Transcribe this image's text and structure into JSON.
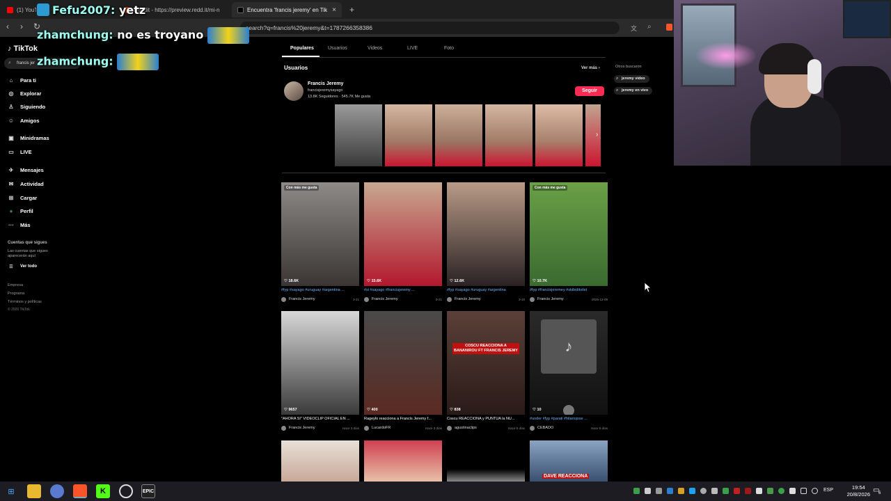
{
  "browser": {
    "tabs": [
      {
        "label": "(1) YouTu",
        "active": false
      },
      {
        "label": "Reddit - https://preview.redd.it/mi-n",
        "active": false
      },
      {
        "label": "Encuentra 'francis jeremy' en Tik",
        "active": true
      }
    ],
    "new_tab": "+",
    "url": "search?q=francis%20jeremy&t=1787266358386"
  },
  "chat": [
    {
      "user": "Fefu2007:",
      "message": "yetz"
    },
    {
      "user": "zhamchung:",
      "message": "no es troyano"
    },
    {
      "user": "zhamchung:",
      "message": ""
    }
  ],
  "tiktok": {
    "logo": "TikTok",
    "search_value": "francis jer",
    "nav": [
      {
        "label": "Para ti",
        "icon": "home-icon"
      },
      {
        "label": "Explorar",
        "icon": "compass-icon"
      },
      {
        "label": "Siguiendo",
        "icon": "person-icon"
      },
      {
        "label": "Amigos",
        "icon": "friends-icon"
      },
      {
        "label": "Minidramas",
        "icon": "minidrama-icon"
      },
      {
        "label": "LIVE",
        "icon": "live-icon"
      },
      {
        "label": "Mensajes",
        "icon": "messages-icon"
      },
      {
        "label": "Actividad",
        "icon": "activity-icon"
      },
      {
        "label": "Cargar",
        "icon": "upload-icon"
      },
      {
        "label": "Perfil",
        "icon": "profile-icon"
      },
      {
        "label": "Más",
        "icon": "more-icon"
      }
    ],
    "following_heading": "Cuentas que sigues",
    "following_text_1": "Las cuentas que sigues",
    "following_text_2": "aparecerán aquí",
    "see_all": "Ver todo",
    "footer": [
      "Empresa",
      "Programa",
      "Términos y políticas",
      "© 2026 TikTok"
    ],
    "content_tabs": [
      "Populares",
      "Usuarios",
      "Videos",
      "LIVE",
      "Foto"
    ],
    "users_section": {
      "title": "Usuarios",
      "see_more": "Ver más",
      "name": "Francis Jeremy",
      "handle": "francisjeremysayago",
      "stats": "13.8K Seguidores · 545.7K Me gusta",
      "follow": "Seguir"
    },
    "others_searched": {
      "title": "Otros buscaron",
      "items": [
        "jeremy video",
        "jeremy en vivo"
      ]
    },
    "videos": [
      {
        "badge": "Con más me gusta",
        "likes": "18.6K",
        "caption_tags": "#fyp #sayago #uruguay #argentina ...",
        "author": "Francis Jeremy",
        "date": "3-21",
        "color1": "#8d8a88",
        "color2": "#3a3533"
      },
      {
        "badge": "",
        "likes": "15.6K",
        "caption_tags": "#si #sayago #francisjeremy ...",
        "author": "Francis Jeremy",
        "date": "3-21",
        "color1": "#c8a890",
        "color2": "#b2182e"
      },
      {
        "badge": "",
        "likes": "12.6K",
        "caption_tags": "#fyp #sayago #uruguay #argentina",
        "author": "Francis Jeremy",
        "date": "3-15",
        "color1": "#b89a86",
        "color2": "#2a2224"
      },
      {
        "badge": "Con más me gusta",
        "likes": "10.7K",
        "caption_tags": "#fyp #francisjeremey #skibiditoilet",
        "author": "Francis Jeremy",
        "date": "2025-12-09",
        "color1": "#6aa046",
        "color2": "#3a6a30"
      },
      {
        "badge": "",
        "likes": "9657",
        "caption_tags": "\"AHORA SI\" VIDEOCLIP OFICIAL EN ...",
        "author": "Francis Jeremy",
        "date": "Hace 3 días",
        "color1": "#d8d8d8",
        "color2": "#3a3a3a"
      },
      {
        "badge": "",
        "likes": "400",
        "caption_tags": "Rageylo reacciona a Francis Jeremy f...",
        "author": "LucardoFR",
        "date": "Hace 3 días",
        "color1": "#4a4a4a",
        "color2": "#5a2a22"
      },
      {
        "badge": "",
        "likes": "838",
        "caption_tags": "Coscu REACCIONA y PUNTUA la NU...",
        "author": "agustinaclips",
        "date": "Hace 5 días",
        "color1": "#5a4038",
        "color2": "#2a1a18"
      },
      {
        "badge": "",
        "likes": "10",
        "caption_tags": "#under #fyp #parati #hilariojose ...",
        "author": "CEBADO",
        "date": "Hace 5 días",
        "color1": "#2a2a2a",
        "color2": "#111111"
      }
    ],
    "overlay_text": {
      "coscu": "COSCU REACCIONA A BANANIROU FT FRANCIS JEREMY",
      "dave": "DAVE REACCIONA"
    }
  },
  "taskbar": {
    "lang": "ESP",
    "time": "19:54",
    "date": "20/8/2026",
    "notification_count": "6"
  }
}
